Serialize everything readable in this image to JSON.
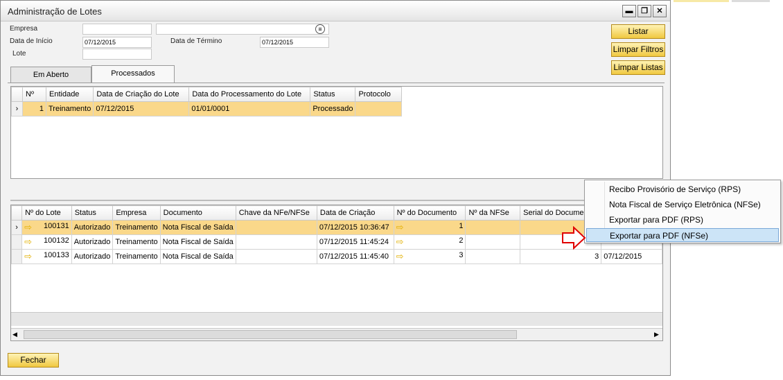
{
  "window": {
    "title": "Administração de Lotes"
  },
  "titlebar_buttons": {
    "min": "▬",
    "max": "❐",
    "close": "✕"
  },
  "form": {
    "empresa_label": "Empresa",
    "data_inicio_label": "Data de Início",
    "data_inicio_value": "07/12/2015",
    "data_termino_label": "Data de Término",
    "data_termino_value": "07/12/2015",
    "lote_label": "Lote"
  },
  "buttons": {
    "listar": "Listar",
    "limpar_filtros": "Limpar Filtros",
    "limpar_listas": "Limpar Listas",
    "fechar": "Fechar"
  },
  "tabs": [
    {
      "label": "Em Aberto"
    },
    {
      "label": "Processados"
    }
  ],
  "lotes_grid": {
    "columns": [
      "Nº",
      "Entidade",
      "Data de Criação do Lote",
      "Data do Processamento do Lote",
      "Status",
      "Protocolo"
    ],
    "rows": [
      {
        "num": "1",
        "entidade": "Treinamento",
        "criacao": "07/12/2015",
        "processamento": "01/01/0001",
        "status": "Processado",
        "protocolo": ""
      }
    ]
  },
  "docs_grid": {
    "columns": [
      "Nº do Lote",
      "Status",
      "Empresa",
      "Documento",
      "Chave da NFe/NFSe",
      "Data de Criação",
      "Nº do Documento",
      "Nº da NFSe",
      "Serial do Documento"
    ],
    "rows": [
      {
        "lote": "100131",
        "status": "Autorizado",
        "empresa": "Treinamento",
        "documento": "Nota Fiscal de Saída",
        "chave": "",
        "criacao": "07/12/2015 10:36:47",
        "num_doc": "1",
        "nfse": "",
        "serial": "",
        "extra": ""
      },
      {
        "lote": "100132",
        "status": "Autorizado",
        "empresa": "Treinamento",
        "documento": "Nota Fiscal de Saída",
        "chave": "",
        "criacao": "07/12/2015 11:45:24",
        "num_doc": "2",
        "nfse": "",
        "serial": "",
        "extra": ""
      },
      {
        "lote": "100133",
        "status": "Autorizado",
        "empresa": "Treinamento",
        "documento": "Nota Fiscal de Saída",
        "chave": "",
        "criacao": "07/12/2015 11:45:40",
        "num_doc": "3",
        "nfse": "",
        "serial": "3",
        "extra": "07/12/2015"
      }
    ]
  },
  "context_menu": {
    "items": [
      {
        "label": "Recibo Provisório de Serviço (RPS)"
      },
      {
        "label": "Nota Fiscal de Serviço Eletrônica (NFSe)"
      },
      {
        "label": "Exportar para PDF (RPS)"
      },
      {
        "label": "Exportar para PDF (NFSe)"
      }
    ]
  },
  "icons": {
    "row_pointer": "chevron-right-icon",
    "doc_link": "link-arrow-icon",
    "empresa_picker": "list-icon"
  },
  "colors": {
    "gold_button": "#f0c840",
    "selected_row": "#fad88a",
    "menu_highlight": "#cce4f7",
    "annotation_arrow": "#e00000"
  }
}
